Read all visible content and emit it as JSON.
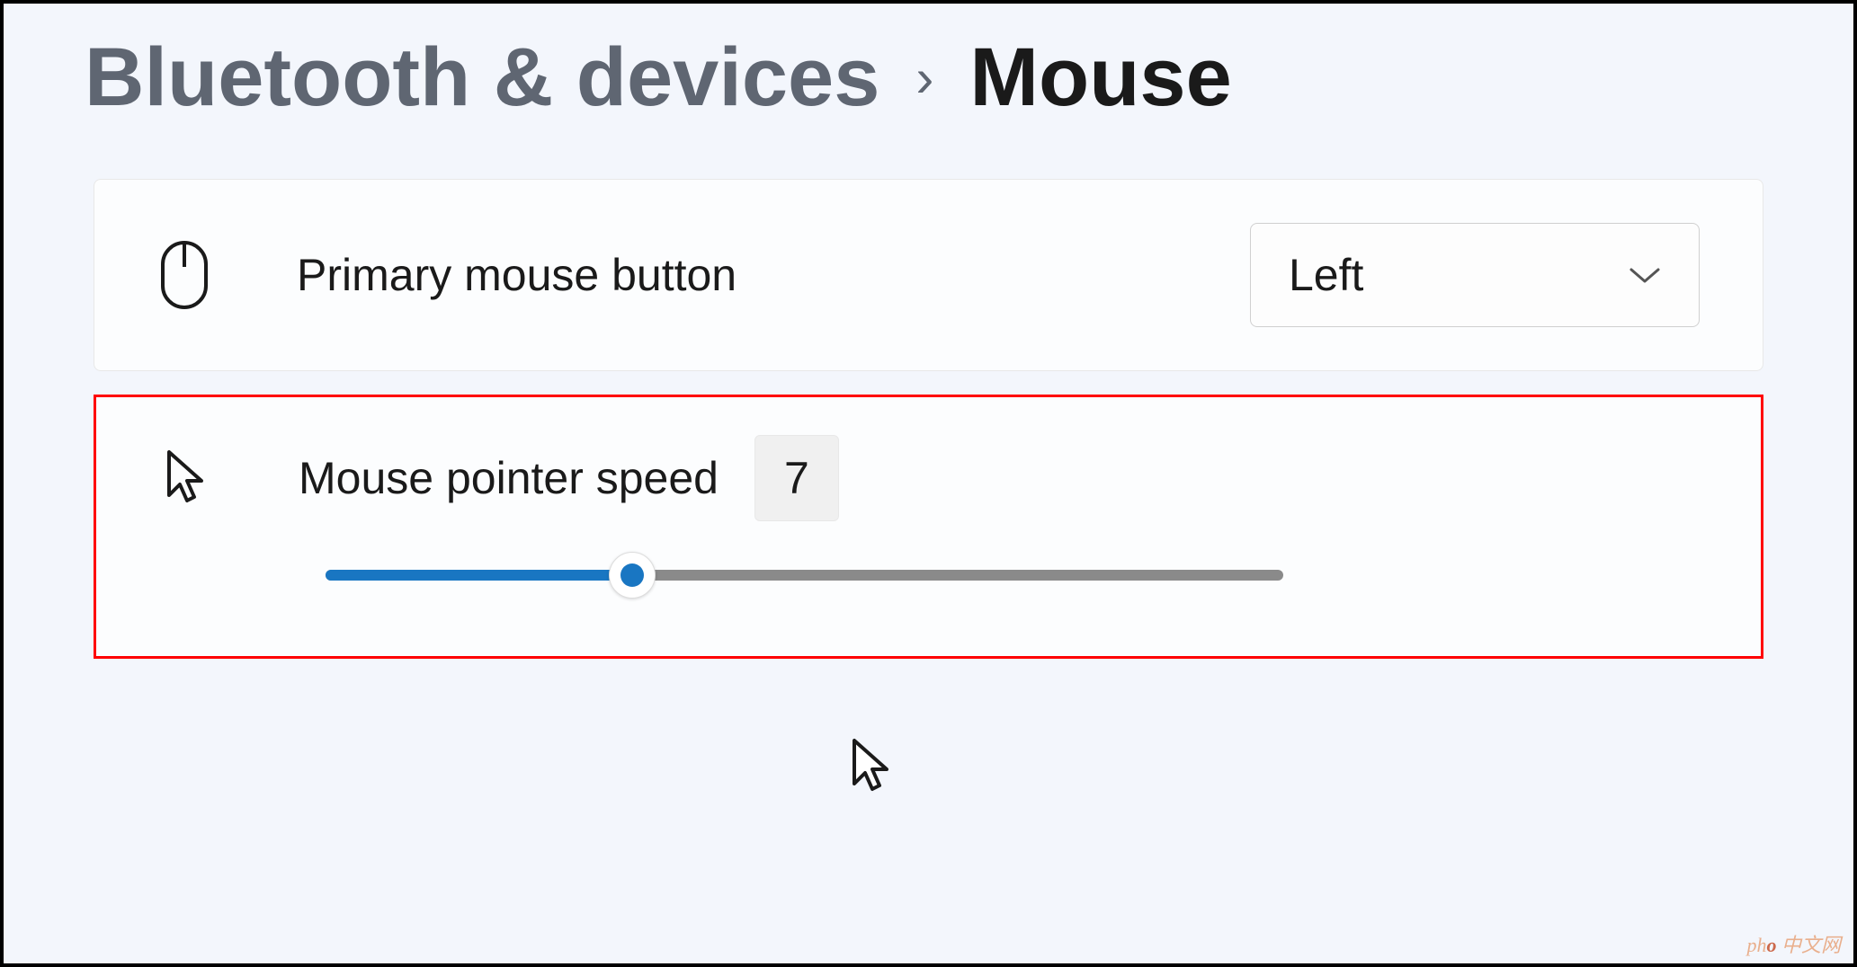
{
  "breadcrumb": {
    "parent": "Bluetooth & devices",
    "separator": "›",
    "current": "Mouse"
  },
  "primary_button": {
    "label": "Primary mouse button",
    "dropdown_value": "Left"
  },
  "pointer_speed": {
    "label": "Mouse pointer speed",
    "value": "7",
    "slider_percent": 32,
    "slider_min": 1,
    "slider_max": 20
  },
  "watermark": {
    "text_prefix": "ph",
    "text_o": "o",
    "text_suffix": " 中文网"
  },
  "colors": {
    "accent": "#1976c2",
    "highlight_border": "#ff0000",
    "bg": "#f3f6fc",
    "card_bg": "#fcfdfe",
    "text_muted": "#5f6672",
    "text": "#1a1a1a"
  }
}
